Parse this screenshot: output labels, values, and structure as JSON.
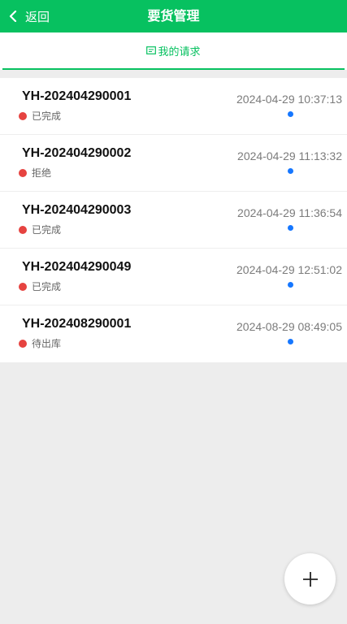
{
  "header": {
    "back_label": "返回",
    "title": "要货管理",
    "bg_color": "#07c160"
  },
  "tabs": [
    {
      "label": "我的请求",
      "icon": "ticket-icon",
      "active": true
    }
  ],
  "requests": [
    {
      "order_no": "YH-202404290001",
      "status": "已完成",
      "time": "2024-04-29 10:37:13"
    },
    {
      "order_no": "YH-202404290002",
      "status": "拒绝",
      "time": "2024-04-29 11:13:32"
    },
    {
      "order_no": "YH-202404290003",
      "status": "已完成",
      "time": "2024-04-29 11:36:54"
    },
    {
      "order_no": "YH-202404290049",
      "status": "已完成",
      "time": "2024-04-29 12:51:02"
    },
    {
      "order_no": "YH-202408290001",
      "status": "待出库",
      "time": "2024-08-29 08:49:05"
    }
  ],
  "colors": {
    "status_dot": "#e64340",
    "unread_dot": "#1677ff"
  },
  "fab": {
    "icon": "plus-icon"
  }
}
